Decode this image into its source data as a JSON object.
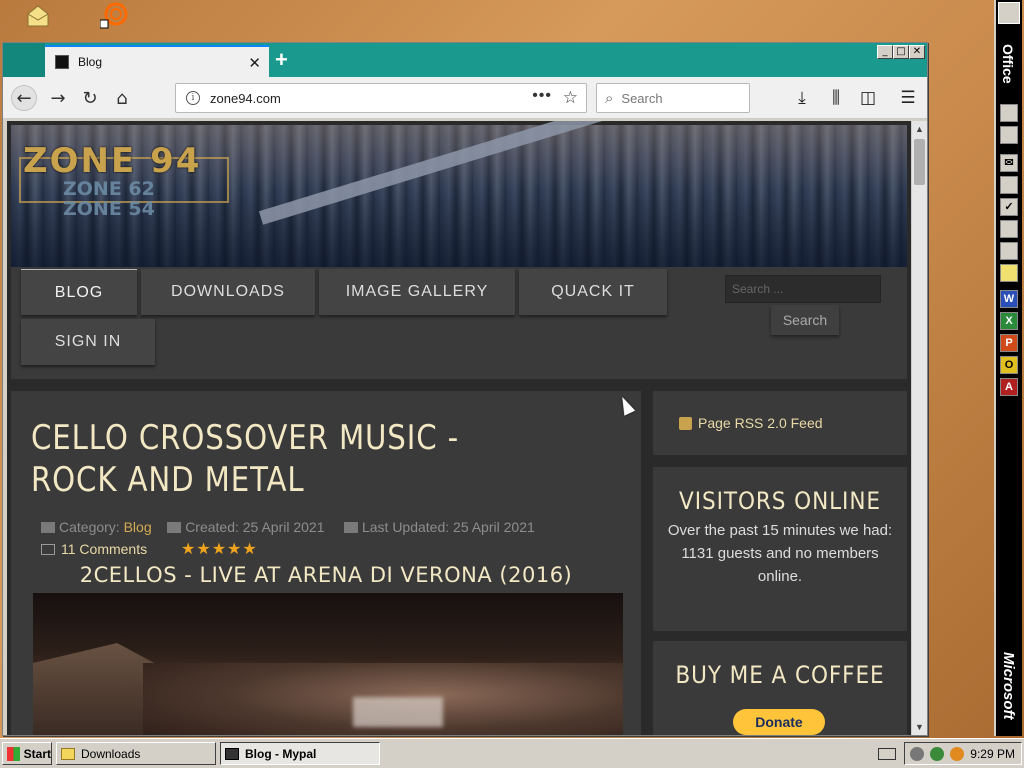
{
  "window": {
    "tab_title": "Blog",
    "new_tab": "+",
    "close_tab": "✕",
    "url": "zone94.com",
    "url_dots": "•••",
    "search_placeholder": "Search",
    "controls": {
      "minimize": "_",
      "maximize": "□",
      "close": "✕"
    }
  },
  "page": {
    "logo_main": "ZONE 94",
    "logo_sub1": "ZONE 62",
    "logo_sub2": "ZONE 54",
    "menu": [
      "BLOG",
      "DOWNLOADS",
      "IMAGE GALLERY",
      "QUACK IT",
      "SIGN IN"
    ],
    "nav_search_placeholder": "Search ...",
    "nav_search_button": "Search",
    "article": {
      "title": "CELLO CROSSOVER MUSIC - ROCK AND METAL",
      "category_label": "Category:",
      "category": "Blog",
      "created": "Created: 25 April 2021",
      "updated": "Last Updated: 25 April 2021",
      "comments": "11 Comments",
      "rating": 5,
      "stars": "★★★★★",
      "subtitle": "2CELLOS - LIVE AT ARENA DI VERONA (2016)"
    },
    "sidebar": {
      "rss": "Page RSS 2.0 Feed",
      "visitors_title": "VISITORS ONLINE",
      "visitors_text_1": "Over the past 15 minutes we had:",
      "visitors_text_2": "1131 guests and no members online.",
      "coffee_title": "BUY ME A COFFEE",
      "donate": "Donate"
    }
  },
  "officebar": {
    "label": "Office",
    "brand": "Microsoft"
  },
  "taskbar": {
    "start": "Start",
    "tasks": [
      "Downloads",
      "Blog - Mypal"
    ],
    "clock": "9:29 PM"
  },
  "colors": {
    "tab_bar": "#1a9a8e",
    "accent_gold": "#c9a24e",
    "title_cream": "#f3e8c4",
    "donate_yellow": "#ffc439"
  }
}
